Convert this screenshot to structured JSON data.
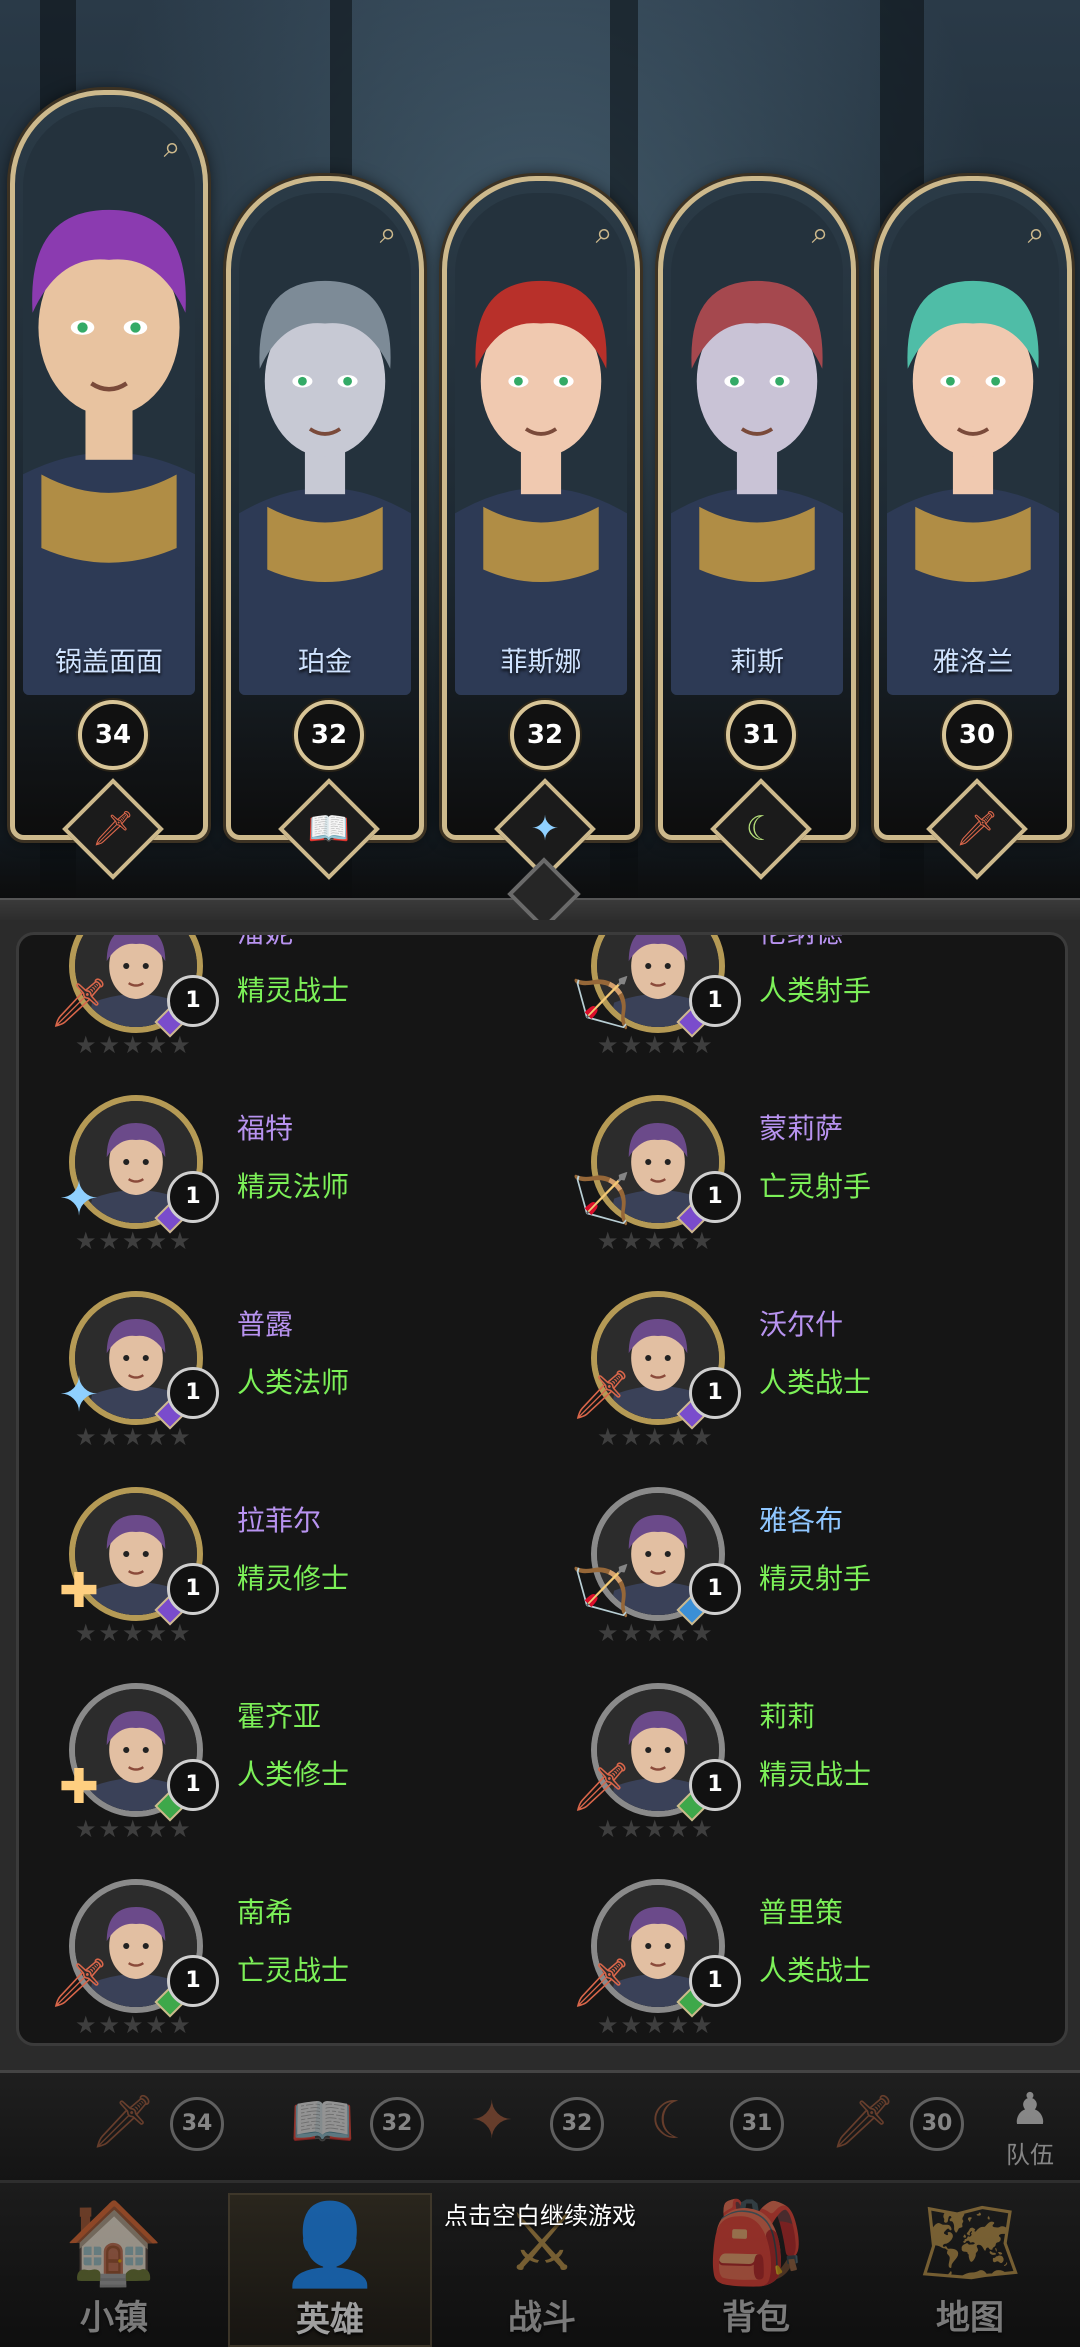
{
  "party": {
    "members": [
      {
        "name": "锅盖面面",
        "level": "34",
        "class_icon": "sword-icon",
        "hair": "#8b3bb0",
        "skin": "#e8c3a0"
      },
      {
        "name": "珀金",
        "level": "32",
        "class_icon": "spellbook-icon",
        "hair": "#7d8b97",
        "skin": "#c7c9d4"
      },
      {
        "name": "菲斯娜",
        "level": "32",
        "class_icon": "staff-icon",
        "hair": "#b8302a",
        "skin": "#f0c9b0"
      },
      {
        "name": "莉斯",
        "level": "31",
        "class_icon": "sickle-icon",
        "hair": "#a5484e",
        "skin": "#c9c3d6"
      },
      {
        "name": "雅洛兰",
        "level": "30",
        "class_icon": "sword-icon",
        "hair": "#4fbda7",
        "skin": "#f0c9b0"
      }
    ]
  },
  "hero_list": {
    "heroes": [
      {
        "name": "潘妮",
        "role": "精灵战士",
        "level": "1",
        "name_color": "#b893f0",
        "class_icon": "sword-icon",
        "gem": "#7a4ccc",
        "frame": "gold"
      },
      {
        "name": "伦纳德",
        "role": "人类射手",
        "level": "1",
        "name_color": "#b893f0",
        "class_icon": "bow-icon",
        "gem": "#7a4ccc",
        "frame": "gold"
      },
      {
        "name": "福特",
        "role": "精灵法师",
        "level": "1",
        "name_color": "#b893f0",
        "class_icon": "staff-icon",
        "gem": "#7a4ccc",
        "frame": "gold"
      },
      {
        "name": "蒙莉萨",
        "role": "亡灵射手",
        "level": "1",
        "name_color": "#b893f0",
        "class_icon": "bow-icon",
        "gem": "#7a4ccc",
        "frame": "gold"
      },
      {
        "name": "普露",
        "role": "人类法师",
        "level": "1",
        "name_color": "#b893f0",
        "class_icon": "staff-icon",
        "gem": "#7a4ccc",
        "frame": "gold"
      },
      {
        "name": "沃尔什",
        "role": "人类战士",
        "level": "1",
        "name_color": "#b893f0",
        "class_icon": "sword-icon",
        "gem": "#7a4ccc",
        "frame": "gold"
      },
      {
        "name": "拉菲尔",
        "role": "精灵修士",
        "level": "1",
        "name_color": "#b893f0",
        "class_icon": "holy-cross-icon",
        "gem": "#7a4ccc",
        "frame": "gold"
      },
      {
        "name": "雅各布",
        "role": "精灵射手",
        "level": "1",
        "name_color": "#8fc6ff",
        "class_icon": "bow-icon",
        "gem": "#3b8fd6",
        "frame": "silver"
      },
      {
        "name": "霍齐亚",
        "role": "人类修士",
        "level": "1",
        "name_color": "#7cf058",
        "class_icon": "holy-cross-icon",
        "gem": "#3ea84a",
        "frame": "silver"
      },
      {
        "name": "莉莉",
        "role": "精灵战士",
        "level": "1",
        "name_color": "#7cf058",
        "class_icon": "sword-icon",
        "gem": "#3ea84a",
        "frame": "silver"
      },
      {
        "name": "南希",
        "role": "亡灵战士",
        "level": "1",
        "name_color": "#7cf058",
        "class_icon": "sword-icon",
        "gem": "#3ea84a",
        "frame": "silver"
      },
      {
        "name": "普里策",
        "role": "人类战士",
        "level": "1",
        "name_color": "#7cf058",
        "class_icon": "sword-icon",
        "gem": "#3ea84a",
        "frame": "silver"
      }
    ],
    "stars": "★★★★★"
  },
  "mini_bar": {
    "levels": [
      "34",
      "32",
      "32",
      "31",
      "30"
    ],
    "team_label": "队伍"
  },
  "nav": {
    "items": [
      {
        "label": "小镇",
        "icon": "town-icon"
      },
      {
        "label": "英雄",
        "icon": "hero-icon"
      },
      {
        "label": "战斗",
        "icon": "battle-icon"
      },
      {
        "label": "背包",
        "icon": "backpack-icon"
      },
      {
        "label": "地图",
        "icon": "map-icon"
      }
    ],
    "continue_hint": "点击空白继续游戏"
  }
}
